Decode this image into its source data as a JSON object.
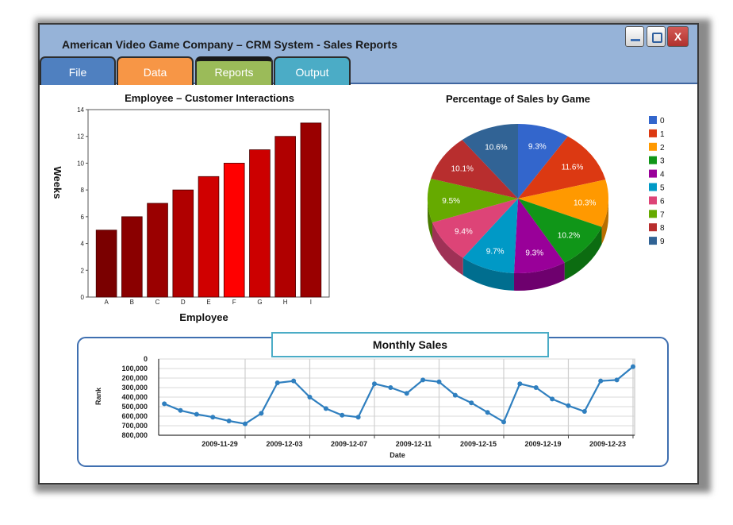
{
  "window": {
    "title": "American Video Game Company – CRM System - Sales Reports",
    "close_label": "X"
  },
  "tabs": [
    {
      "label": "File",
      "color": "#4f80c0"
    },
    {
      "label": "Data",
      "color": "#f79646"
    },
    {
      "label": "Reports",
      "color": "#9bbb59",
      "active": true
    },
    {
      "label": "Output",
      "color": "#4bacc6"
    }
  ],
  "chart_data": [
    {
      "type": "bar",
      "title": "Employee – Customer Interactions",
      "xlabel": "Employee",
      "ylabel": "Weeks",
      "categories": [
        "A",
        "B",
        "C",
        "D",
        "E",
        "F",
        "G",
        "H",
        "I"
      ],
      "values": [
        5,
        6,
        7,
        8,
        9,
        10,
        11,
        12,
        13
      ],
      "ylim": [
        0,
        14
      ],
      "yticks": [
        "0",
        "2",
        "4",
        "6",
        "8",
        "10",
        "12",
        "14"
      ],
      "colors": [
        "#7a0000",
        "#8a0000",
        "#9a0000",
        "#b00000",
        "#d00000",
        "#ff0000",
        "#cc0000",
        "#b00000",
        "#9a0000"
      ]
    },
    {
      "type": "pie",
      "title": "Percentage of Sales by Game",
      "labels": [
        "0",
        "1",
        "2",
        "3",
        "4",
        "5",
        "6",
        "7",
        "8",
        "9"
      ],
      "values": [
        9.3,
        11.6,
        10.3,
        10.2,
        9.3,
        9.7,
        9.4,
        9.5,
        10.1,
        10.6
      ],
      "value_labels": [
        "9.3%",
        "11.6%",
        "10.3%",
        "10.2%",
        "9.3%",
        "9.7%",
        "9.4%",
        "9.5%",
        "10.1%",
        "10.6%"
      ],
      "colors": [
        "#3366cc",
        "#dc3912",
        "#ff9900",
        "#109618",
        "#990099",
        "#0099c6",
        "#dd4477",
        "#66aa00",
        "#b82e2e",
        "#316395"
      ],
      "legend": "right"
    },
    {
      "type": "line",
      "title": "Monthly Sales",
      "xlabel": "Date",
      "ylabel": "Rank",
      "y_reversed": true,
      "ylim": [
        0,
        800000
      ],
      "yticks": [
        "0",
        "100,000",
        "200,000",
        "300,000",
        "400,000",
        "500,000",
        "600,000",
        "700,000",
        "800,000"
      ],
      "xticks": [
        "2009-11-29",
        "2009-12-03",
        "2009-12-07",
        "2009-12-11",
        "2009-12-15",
        "2009-12-19",
        "2009-12-23"
      ],
      "x": [
        "2009-11-24",
        "2009-11-25",
        "2009-11-26",
        "2009-11-27",
        "2009-11-28",
        "2009-11-29",
        "2009-11-30",
        "2009-12-01",
        "2009-12-02",
        "2009-12-03",
        "2009-12-04",
        "2009-12-05",
        "2009-12-06",
        "2009-12-07",
        "2009-12-08",
        "2009-12-09",
        "2009-12-10",
        "2009-12-11",
        "2009-12-12",
        "2009-12-13",
        "2009-12-14",
        "2009-12-15",
        "2009-12-16",
        "2009-12-17",
        "2009-12-18",
        "2009-12-19",
        "2009-12-20",
        "2009-12-21",
        "2009-12-22",
        "2009-12-23"
      ],
      "values": [
        470000,
        540000,
        580000,
        610000,
        650000,
        680000,
        570000,
        250000,
        230000,
        400000,
        520000,
        590000,
        610000,
        260000,
        300000,
        360000,
        220000,
        240000,
        380000,
        460000,
        560000,
        660000,
        260000,
        300000,
        420000,
        490000,
        550000,
        230000,
        220000,
        80000
      ],
      "color": "#2f7fbf"
    }
  ]
}
